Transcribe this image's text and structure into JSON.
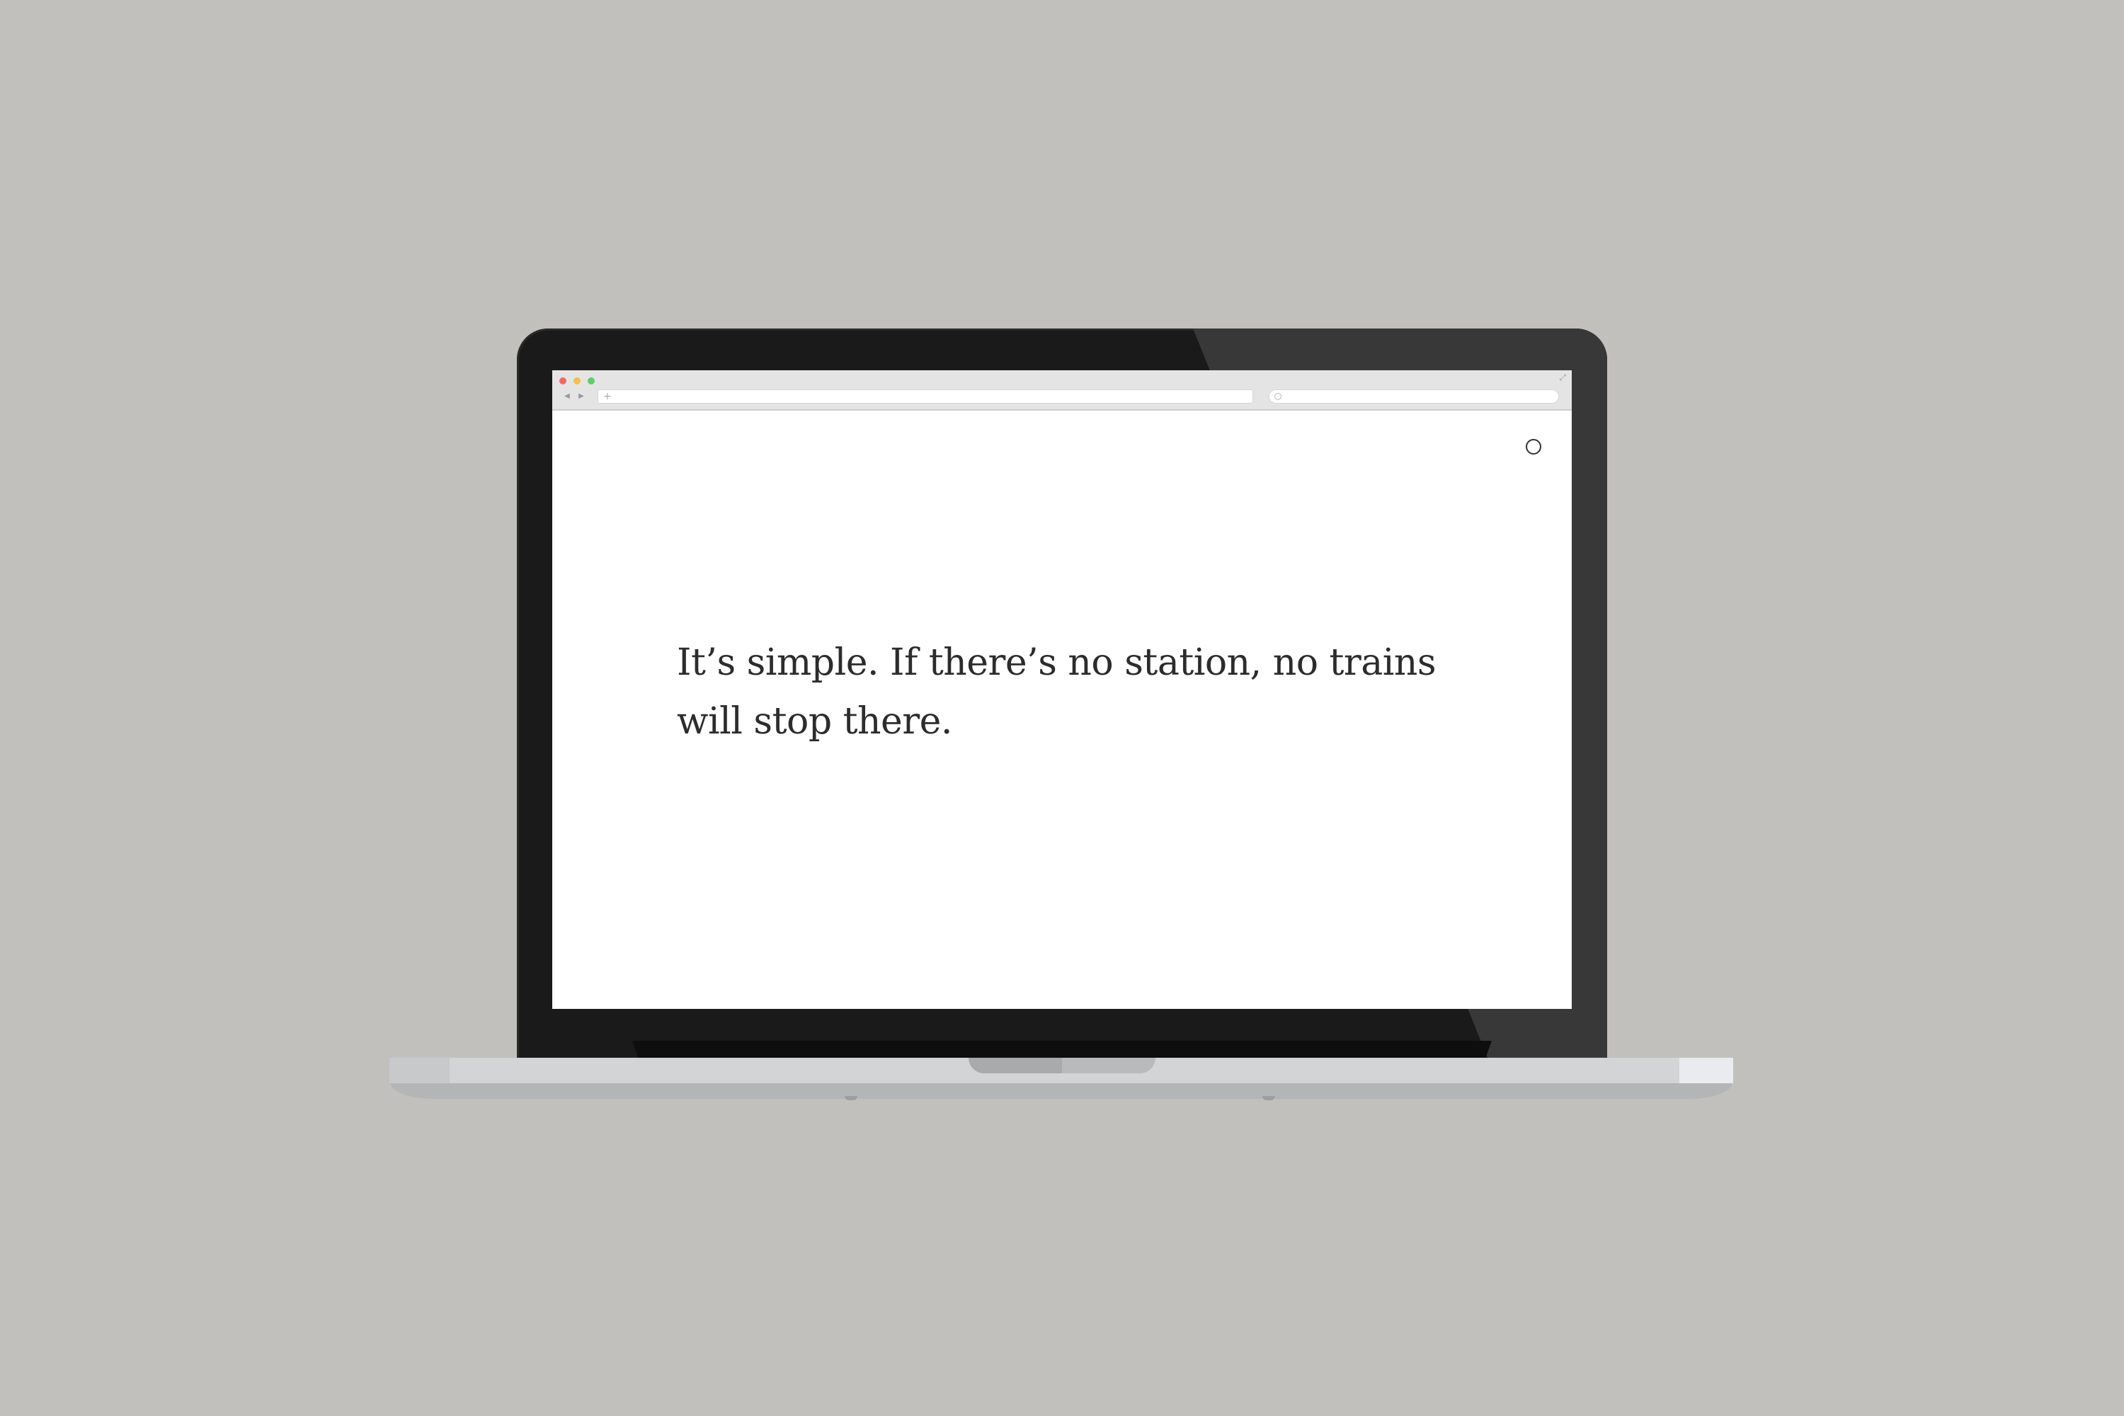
{
  "page": {
    "quote_text": "It’s simple. If there’s no station, no trains will stop there."
  },
  "browser": {
    "nav_back_symbol": "◀",
    "nav_forward_symbol": "▶",
    "url_plus_symbol": "+",
    "expand_symbol": "⤢"
  },
  "icons": {
    "circle_button": "circle-outline-icon",
    "search": "search-icon",
    "expand": "expand-icon"
  },
  "colors": {
    "background": "#c1c0bd",
    "bezel": "#1a1a1a",
    "screen": "#ffffff",
    "text": "#2c2c2c",
    "traffic_red": "#f16a5e",
    "traffic_yellow": "#f5bd4f",
    "traffic_green": "#5fcf69"
  }
}
